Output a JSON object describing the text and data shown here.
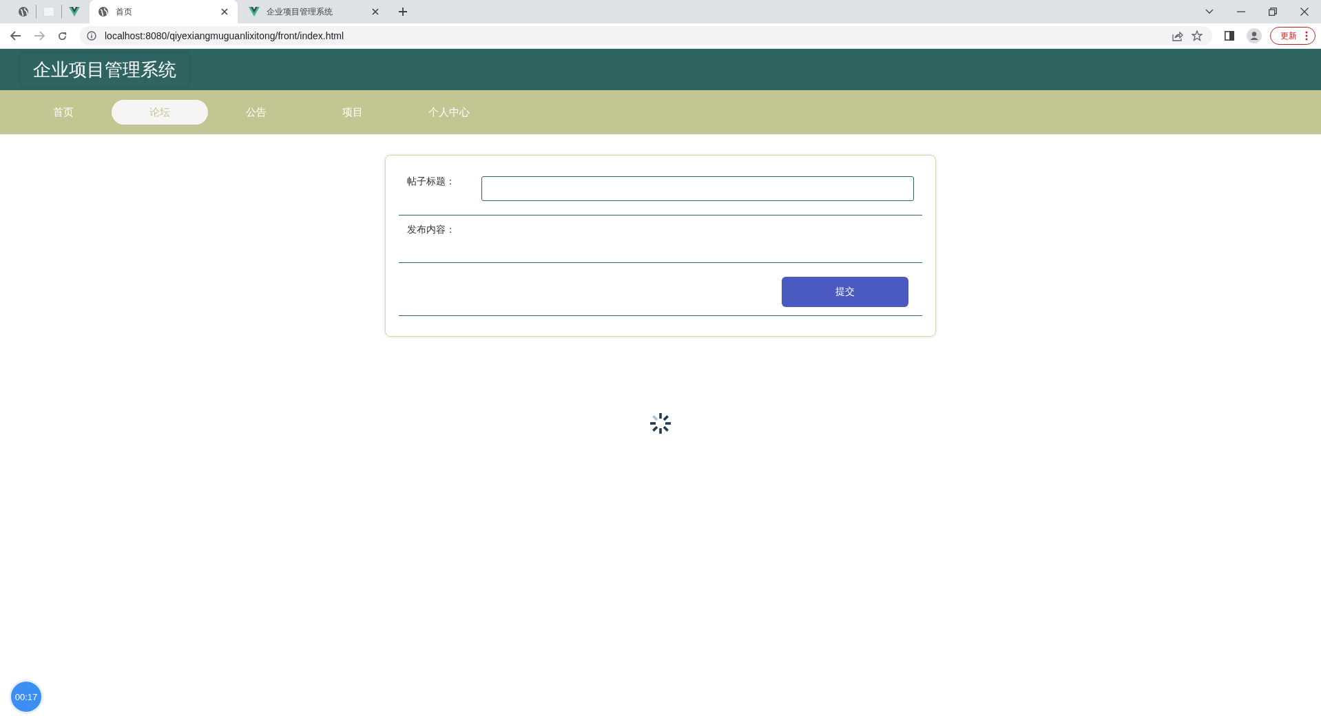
{
  "browser": {
    "pinned_tabs": [
      {
        "kind": "globe",
        "selected": false
      },
      {
        "kind": "blank",
        "selected": false
      },
      {
        "kind": "vue",
        "selected": false
      }
    ],
    "tabs": [
      {
        "label": "首页",
        "kind": "globe",
        "selected": true
      },
      {
        "label": "企业项目管理系统",
        "kind": "vue",
        "selected": false
      }
    ],
    "address": "localhost:8080/qiyexiangmuguanlixitong/front/index.html",
    "update_button": "更新"
  },
  "header": {
    "title": "企业项目管理系统"
  },
  "nav": [
    {
      "label": "首页",
      "selected": false
    },
    {
      "label": "论坛",
      "selected": true
    },
    {
      "label": "公告",
      "selected": false
    },
    {
      "label": "项目",
      "selected": false
    },
    {
      "label": "个人中心",
      "selected": false
    }
  ],
  "form": {
    "fields": [
      {
        "label": "帖子标题：",
        "kind": "input"
      },
      {
        "label": "发布内容：",
        "kind": "editor"
      }
    ],
    "submit": "提交"
  },
  "timer": "00:17"
}
